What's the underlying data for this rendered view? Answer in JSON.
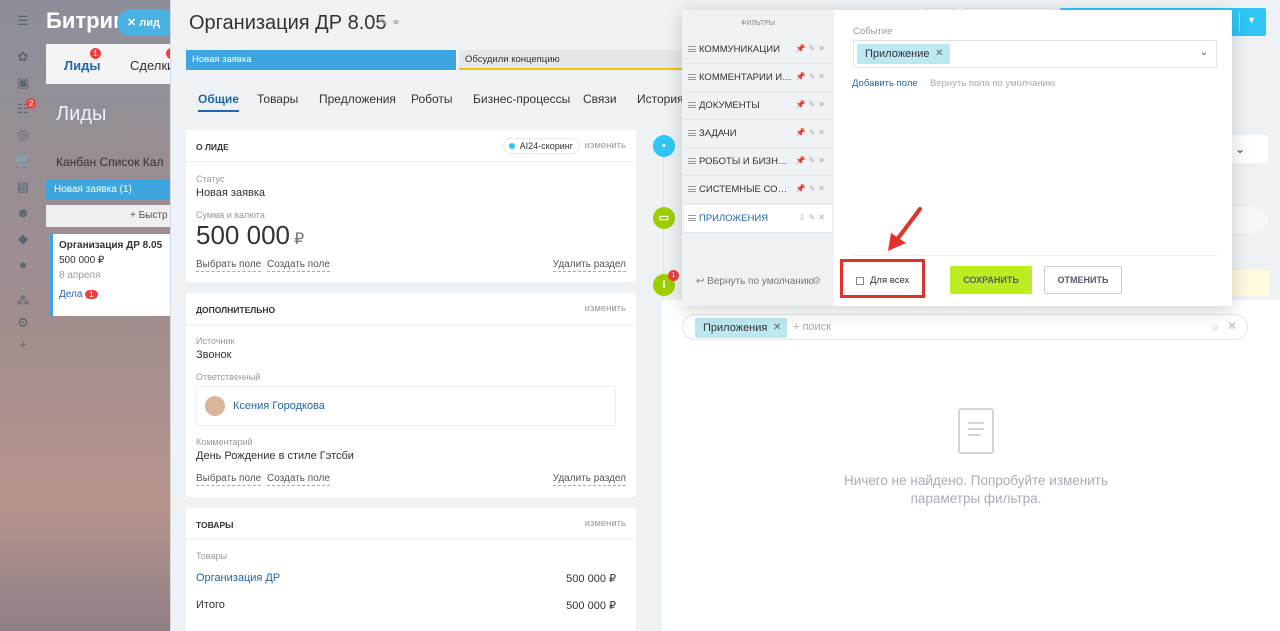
{
  "background": {
    "app_title": "Битрикс",
    "chip_label": "лид",
    "tabs": [
      {
        "label": "Лиды",
        "badge": "1"
      },
      {
        "label": "Сделки",
        "badge": "1"
      }
    ],
    "rail_badge": "2",
    "page_heading": "Лиды",
    "kanban_tabs": "Канбан  Список  Кал",
    "column_title": "Новая заявка (1)",
    "quick_label": "+ Быстр",
    "card": {
      "title": "Организация ДР 8.05",
      "sum": "500 000 ₽",
      "date": "8 апреля",
      "deals_label": "Дела",
      "deals_count": "1"
    }
  },
  "page": {
    "title": "Организация ДР  8.05",
    "stages": [
      "Новая заявка",
      "Обсудили концепцию"
    ],
    "tabs": [
      "Общие",
      "Товары",
      "Предложения",
      "Роботы",
      "Бизнес-процессы",
      "Связи",
      "История"
    ]
  },
  "about": {
    "title": "О лиде",
    "ai_label": "AI24-скоринг",
    "edit_label": "изменить",
    "status_label": "Статус",
    "status_value": "Новая заявка",
    "sum_label": "Сумма и валюта",
    "sum_value": "500 000",
    "currency": "₽",
    "choose_field": "Выбрать поле",
    "create_field": "Создать поле",
    "delete_section": "Удалить раздел"
  },
  "extra": {
    "title": "Дополнительно",
    "edit_label": "изменить",
    "source_label": "Источник",
    "source_value": "Звонок",
    "responsible_label": "Ответственный",
    "responsible_name": "Ксения Городкова",
    "comment_label": "Комментарий",
    "comment_value": "День Рождение в стиле Гэтсби",
    "choose_field": "Выбрать поле",
    "create_field": "Создать поле",
    "delete_section": "Удалить раздел"
  },
  "products": {
    "title": "Товары",
    "edit_label": "изменить",
    "list_label": "Товары",
    "item_name": "Организация ДР",
    "item_sum": "500 000 ₽",
    "total_label": "Итого",
    "total_sum": "500 000 ₽"
  },
  "timeline": {
    "info_badge": "1",
    "search_chip": "Приложения",
    "search_placeholder": "+ поиск",
    "empty_text": "Ничего не найдено. Попробуйте изменить параметры фильтра.",
    "peek_text": "де ⌄"
  },
  "filter_popup": {
    "heading": "Фильтры",
    "items": [
      {
        "label": "Коммуникации"
      },
      {
        "label": "Комментарии и о..."
      },
      {
        "label": "Документы"
      },
      {
        "label": "Задачи"
      },
      {
        "label": "Роботы и бизнес-..."
      },
      {
        "label": "Системные событ..."
      },
      {
        "label": "Приложения"
      }
    ],
    "reset_label": "Вернуть по умолчанию",
    "field_label": "Событие",
    "field_chip": "Приложение",
    "add_field": "Добавить поле",
    "restore_fields": "Вернуть поля по умолчанию",
    "for_all_label": "Для всех",
    "save_label": "Сохранить",
    "cancel_label": "Отменить"
  },
  "colors": {
    "accent": "#2fc6f6",
    "stage_active": "#3da6e0",
    "save_button": "#bbed21",
    "highlight": "#e0322b",
    "link": "#2067b0"
  }
}
